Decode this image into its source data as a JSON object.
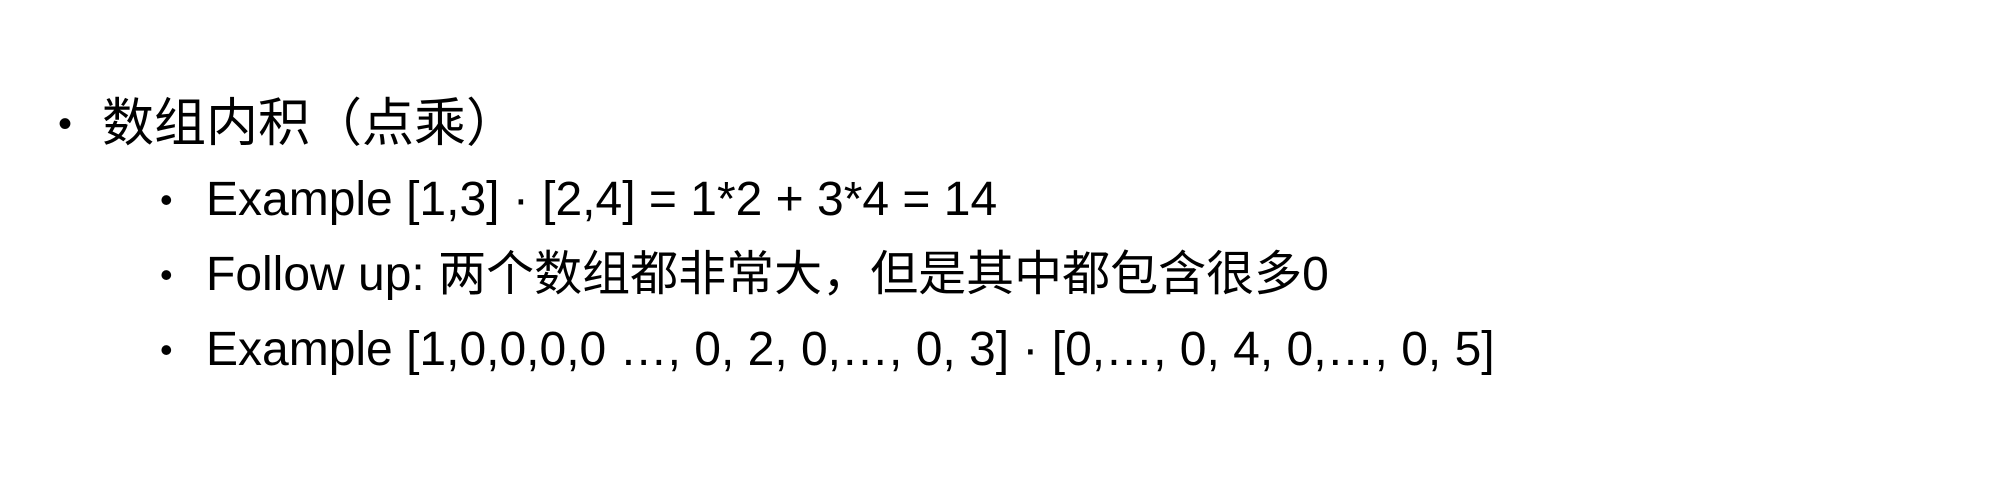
{
  "slide": {
    "bullet_glyph": "•",
    "items": [
      {
        "label": "数组内积（点乘）",
        "children": [
          {
            "label": "Example [1,3] · [2,4] = 1*2 + 3*4 = 14"
          },
          {
            "label": "Follow up: 两个数组都非常大，但是其中都包含很多0"
          },
          {
            "label": "Example [1,0,0,0,0 …, 0, 2, 0,…, 0, 3] · [0,…, 0, 4, 0,…, 0, 5]"
          }
        ]
      }
    ]
  }
}
